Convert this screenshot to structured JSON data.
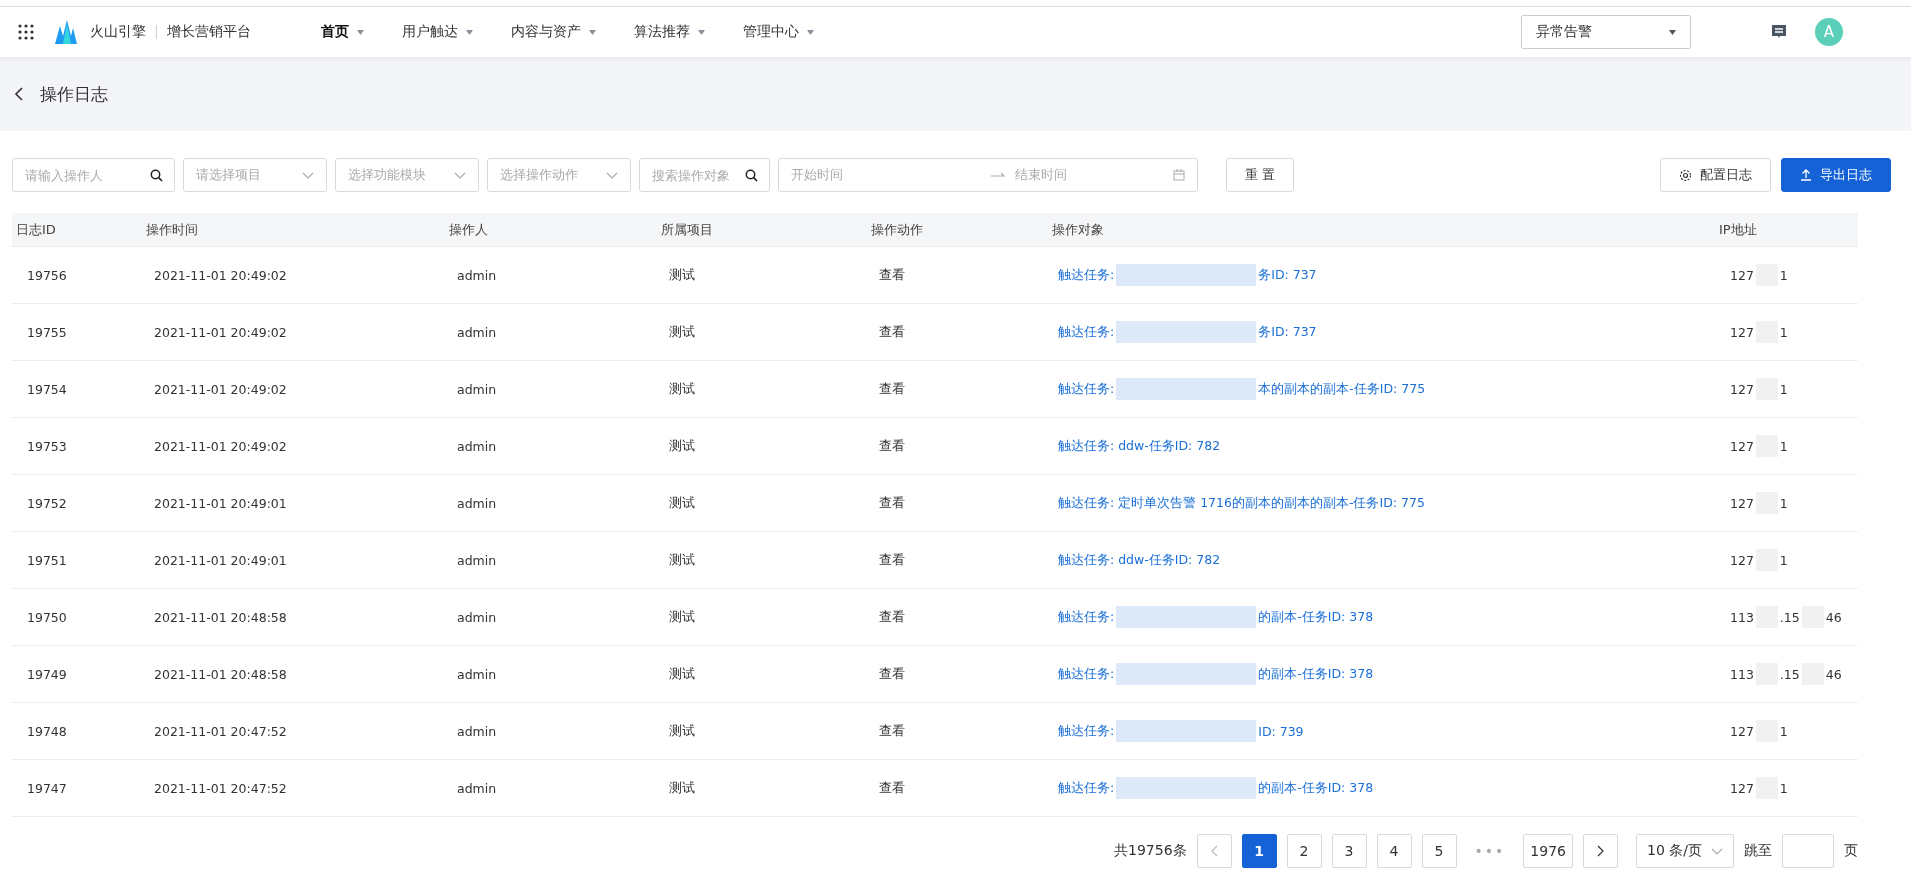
{
  "topbar": {
    "brand": "火山引擎",
    "product": "增长营销平台",
    "nav": [
      {
        "label": "首页",
        "selected": true
      },
      {
        "label": "用户触达",
        "selected": false
      },
      {
        "label": "内容与资产",
        "selected": false
      },
      {
        "label": "算法推荐",
        "selected": false
      },
      {
        "label": "管理中心",
        "selected": false
      }
    ],
    "alert_select": "异常告警",
    "avatar": "A"
  },
  "page": {
    "title": "操作日志"
  },
  "filters": {
    "operator": {
      "placeholder": "请输入操作人"
    },
    "project": {
      "placeholder": "请选择项目"
    },
    "module": {
      "placeholder": "选择功能模块"
    },
    "action": {
      "placeholder": "选择操作动作"
    },
    "target": {
      "placeholder": "搜索操作对象"
    },
    "start": {
      "placeholder": "开始时间"
    },
    "end": {
      "placeholder": "结束时间"
    },
    "reset": "重 置",
    "config": "配置日志",
    "export": "导出日志"
  },
  "table": {
    "columns": [
      "日志ID",
      "操作时间",
      "操作人",
      "所属项目",
      "操作动作",
      "操作对象",
      "IP地址"
    ],
    "rows": [
      {
        "id": "19756",
        "time": "2021-11-01 20:49:02",
        "operator": "admin",
        "project": "测试",
        "action": "查看",
        "object": [
          "触达任务:",
          "务ID: 737"
        ],
        "ip": [
          "127",
          "1"
        ]
      },
      {
        "id": "19755",
        "time": "2021-11-01 20:49:02",
        "operator": "admin",
        "project": "测试",
        "action": "查看",
        "object": [
          "触达任务:",
          "务ID: 737"
        ],
        "ip": [
          "127",
          "1"
        ]
      },
      {
        "id": "19754",
        "time": "2021-11-01 20:49:02",
        "operator": "admin",
        "project": "测试",
        "action": "查看",
        "object": [
          "触达任务:",
          "本的副本的副本-任务ID: 775"
        ],
        "ip": [
          "127",
          "1"
        ]
      },
      {
        "id": "19753",
        "time": "2021-11-01 20:49:02",
        "operator": "admin",
        "project": "测试",
        "action": "查看",
        "object": [
          "触达任务: ddw-任务ID: 782"
        ],
        "ip": [
          "127",
          "1"
        ]
      },
      {
        "id": "19752",
        "time": "2021-11-01 20:49:01",
        "operator": "admin",
        "project": "测试",
        "action": "查看",
        "object": [
          "触达任务: 定时单次告警 1716的副本的副本的副本-任务ID: 775"
        ],
        "ip": [
          "127",
          "1"
        ]
      },
      {
        "id": "19751",
        "time": "2021-11-01 20:49:01",
        "operator": "admin",
        "project": "测试",
        "action": "查看",
        "object": [
          "触达任务: ddw-任务ID: 782"
        ],
        "ip": [
          "127",
          "1"
        ]
      },
      {
        "id": "19750",
        "time": "2021-11-01 20:48:58",
        "operator": "admin",
        "project": "测试",
        "action": "查看",
        "object": [
          "触达任务:",
          "的副本-任务ID: 378"
        ],
        "ip": [
          "113",
          ".15",
          "46"
        ]
      },
      {
        "id": "19749",
        "time": "2021-11-01 20:48:58",
        "operator": "admin",
        "project": "测试",
        "action": "查看",
        "object": [
          "触达任务:",
          "的副本-任务ID: 378"
        ],
        "ip": [
          "113",
          ".15",
          "46"
        ]
      },
      {
        "id": "19748",
        "time": "2021-11-01 20:47:52",
        "operator": "admin",
        "project": "测试",
        "action": "查看",
        "object": [
          "触达任务:",
          "ID: 739"
        ],
        "ip": [
          "127",
          "1"
        ]
      },
      {
        "id": "19747",
        "time": "2021-11-01 20:47:52",
        "operator": "admin",
        "project": "测试",
        "action": "查看",
        "object": [
          "触达任务:",
          "的副本-任务ID: 378"
        ],
        "ip": [
          "127",
          "1"
        ]
      }
    ]
  },
  "pagination": {
    "total": "共19756条",
    "pages": [
      {
        "label": "1",
        "selected": true
      },
      {
        "label": "2",
        "selected": false
      },
      {
        "label": "3",
        "selected": false
      },
      {
        "label": "4",
        "selected": false
      },
      {
        "label": "5",
        "selected": false
      }
    ],
    "ellipsis": "•••",
    "last": "1976",
    "page_size": "10 条/页",
    "jump_label": "跳至",
    "jump_suffix": "页"
  }
}
